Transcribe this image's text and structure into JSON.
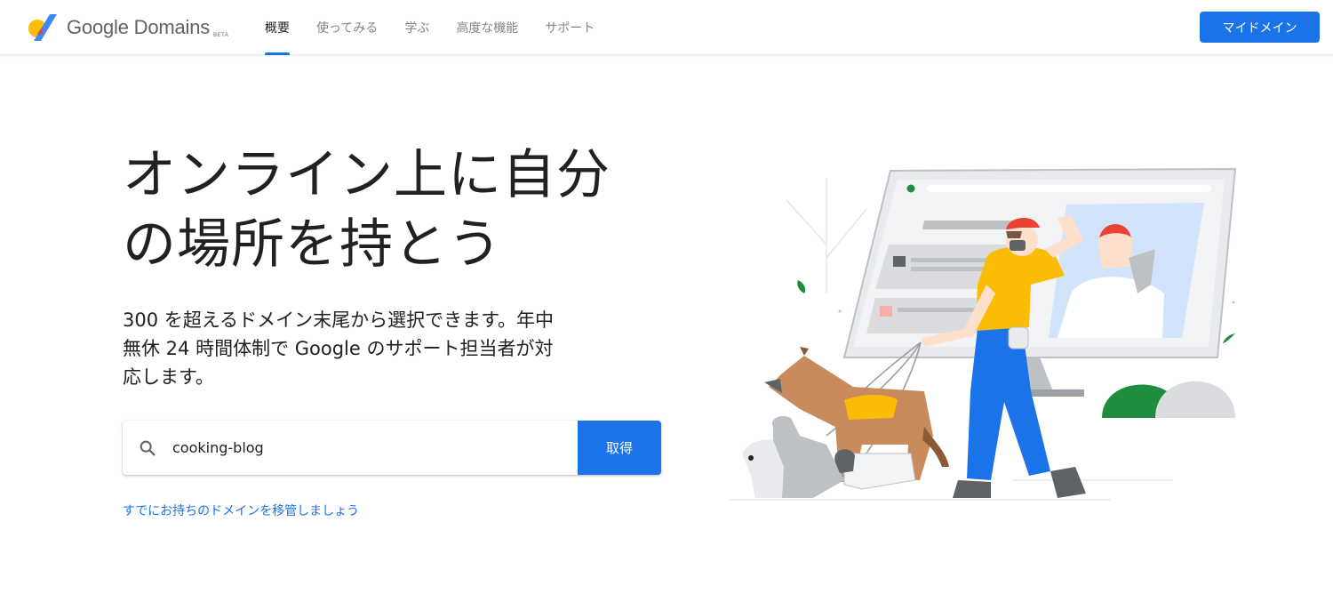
{
  "header": {
    "logo_text": "Google Domains",
    "logo_badge": "BETA",
    "nav": [
      {
        "label": "概要",
        "active": true
      },
      {
        "label": "使ってみる",
        "active": false
      },
      {
        "label": "学ぶ",
        "active": false
      },
      {
        "label": "高度な機能",
        "active": false
      },
      {
        "label": "サポート",
        "active": false
      }
    ],
    "my_domains_label": "マイドメイン"
  },
  "hero": {
    "title_line1": "オンライン上に自分",
    "title_line2": "の場所を持とう",
    "subtitle": "300 を超えるドメイン末尾から選択できます。年中無休 24 時間体制で Google のサポート担当者が対応します。"
  },
  "search": {
    "value": "cooking-blog",
    "icon": "search-icon",
    "button_label": "取得"
  },
  "transfer_link": "すでにお持ちのドメインを移管しましょう",
  "colors": {
    "accent": "#1a73e8",
    "logo_yellow": "#fbbc04",
    "logo_blue": "#4285f4",
    "text": "#202124",
    "nav_inactive": "#80868b"
  }
}
